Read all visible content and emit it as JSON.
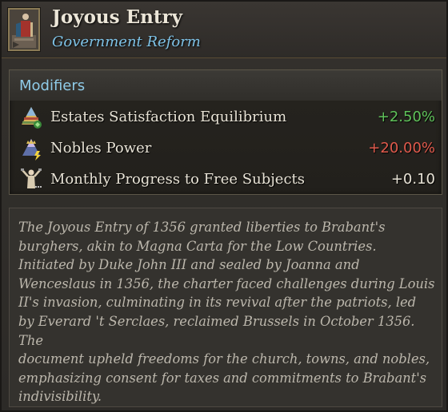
{
  "header": {
    "title": "Joyous Entry",
    "subtitle": "Government Reform",
    "icon": "reform-portrait-icon"
  },
  "modifiers": {
    "heading": "Modifiers",
    "rows": [
      {
        "label": "Estates Satisfaction Equilibrium",
        "value": "+2.50%",
        "value_color": "#5fc25a",
        "icon": "estates-pyramid-icon"
      },
      {
        "label": "Nobles Power",
        "value": "+20.00%",
        "value_color": "#e05a4c",
        "icon": "nobles-crown-icon"
      },
      {
        "label": "Monthly Progress to Free Subjects",
        "value": "+0.10",
        "value_color": "#e8e3d6",
        "icon": "freed-figure-icon"
      }
    ]
  },
  "description": "The Joyous Entry of 1356 granted liberties to Brabant's\nburghers, akin to Magna Carta for the Low Countries.\nInitiated by Duke John III and sealed by Joanna and\nWenceslaus in 1356, the charter faced challenges during Louis\nII's invasion, culminating in its revival after the patriots, led\nby Everard 't Serclaes, reclaimed Brussels in October 1356. The\ndocument upheld freedoms for the church, towns, and nobles,\nemphasizing consent for taxes and commitments to Brabant's\nindivisibility."
}
